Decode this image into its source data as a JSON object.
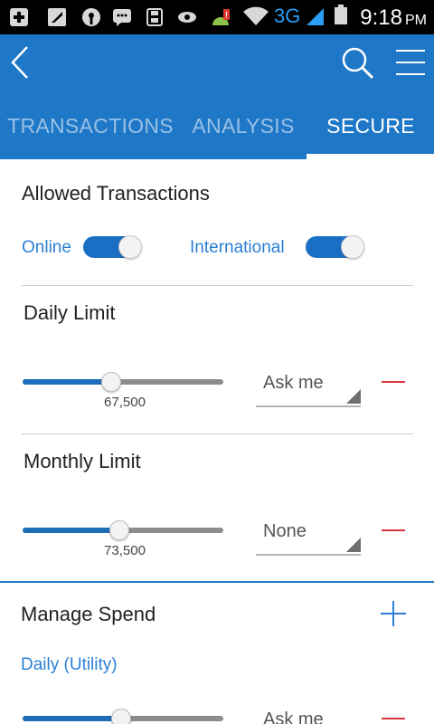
{
  "status_bar": {
    "network": "3G",
    "time": "9:18",
    "ampm": "PM",
    "icons": [
      "add-box-icon",
      "tool-icon",
      "sbi-icon",
      "chat-icon",
      "save-icon",
      "eye-icon",
      "android-alert-icon",
      "wifi-icon",
      "signal-icon",
      "battery-icon"
    ]
  },
  "app_bar": {
    "icons": [
      "back-arrow-icon",
      "search-icon",
      "menu-icon"
    ]
  },
  "tabs": [
    {
      "label": "TRANSACTIONS"
    },
    {
      "label": "ANALYSIS"
    },
    {
      "label": "SECURE",
      "selected": true
    }
  ],
  "allowed": {
    "title": "Allowed Transactions",
    "online_label": "Online",
    "online_on": true,
    "international_label": "International",
    "international_on": true
  },
  "daily_limit": {
    "title": "Daily Limit",
    "value": "67,500",
    "fill": 0.44,
    "option": "Ask me"
  },
  "monthly_limit": {
    "title": "Monthly Limit",
    "value": "73,500",
    "fill": 0.48,
    "option": "None"
  },
  "manage_spend": {
    "title": "Manage Spend",
    "category": "Daily (Utility)",
    "fill": 0.49,
    "option": "Ask me"
  },
  "colors": {
    "primary": "#1e77c7",
    "accent_blue": "#2a7fd4",
    "remove_red": "#d9343f"
  }
}
